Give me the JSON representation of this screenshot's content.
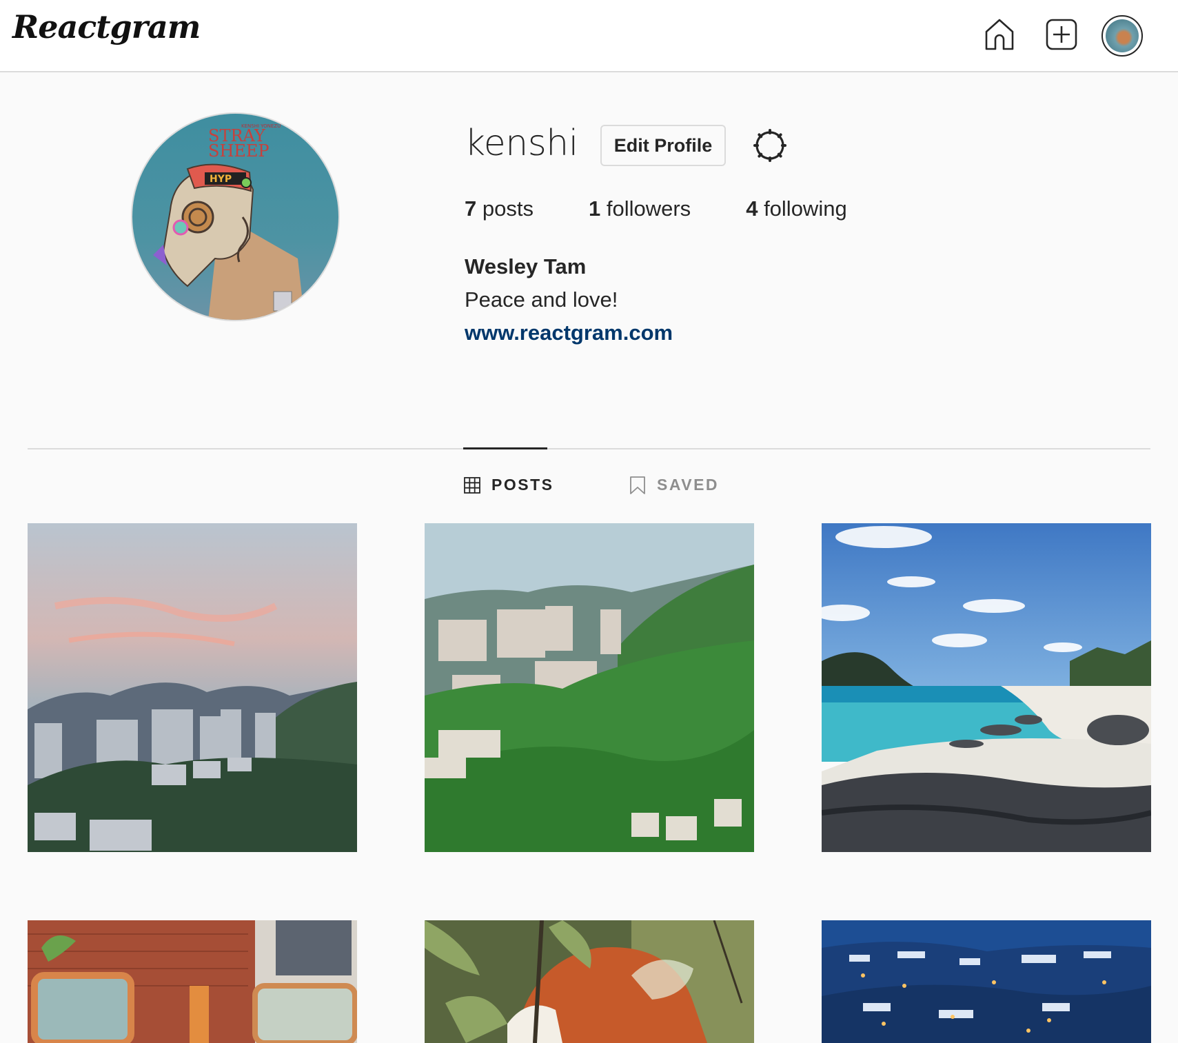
{
  "app": {
    "logo": "Reactgram"
  },
  "nav": {
    "icons": [
      "home-icon",
      "new-post-icon",
      "profile-avatar"
    ]
  },
  "profile": {
    "username": "kenshi",
    "edit_button": "Edit Profile",
    "stats": {
      "posts_count": "7",
      "posts_label": "posts",
      "followers_count": "1",
      "followers_label": "followers",
      "following_count": "4",
      "following_label": "following"
    },
    "full_name": "Wesley Tam",
    "bio": "Peace and love!",
    "website": "www.reactgram.com",
    "avatar_text": {
      "line1": "STRAY",
      "line2": "SHEEP",
      "top": "KENSHI YONEZU"
    }
  },
  "tabs": [
    {
      "label": "POSTS",
      "icon": "grid-icon",
      "active": true
    },
    {
      "label": "SAVED",
      "icon": "bookmark-icon",
      "active": false
    }
  ],
  "posts": [
    {
      "subject": "dusk mountain city"
    },
    {
      "subject": "green hillside apartments"
    },
    {
      "subject": "tropical beach"
    },
    {
      "subject": "street mirrors"
    },
    {
      "subject": "red panda"
    },
    {
      "subject": "snowy night village"
    }
  ],
  "colors": {
    "link": "#00376b",
    "border": "#dbdbdb",
    "text": "#262626",
    "muted": "#8e8e8e"
  }
}
